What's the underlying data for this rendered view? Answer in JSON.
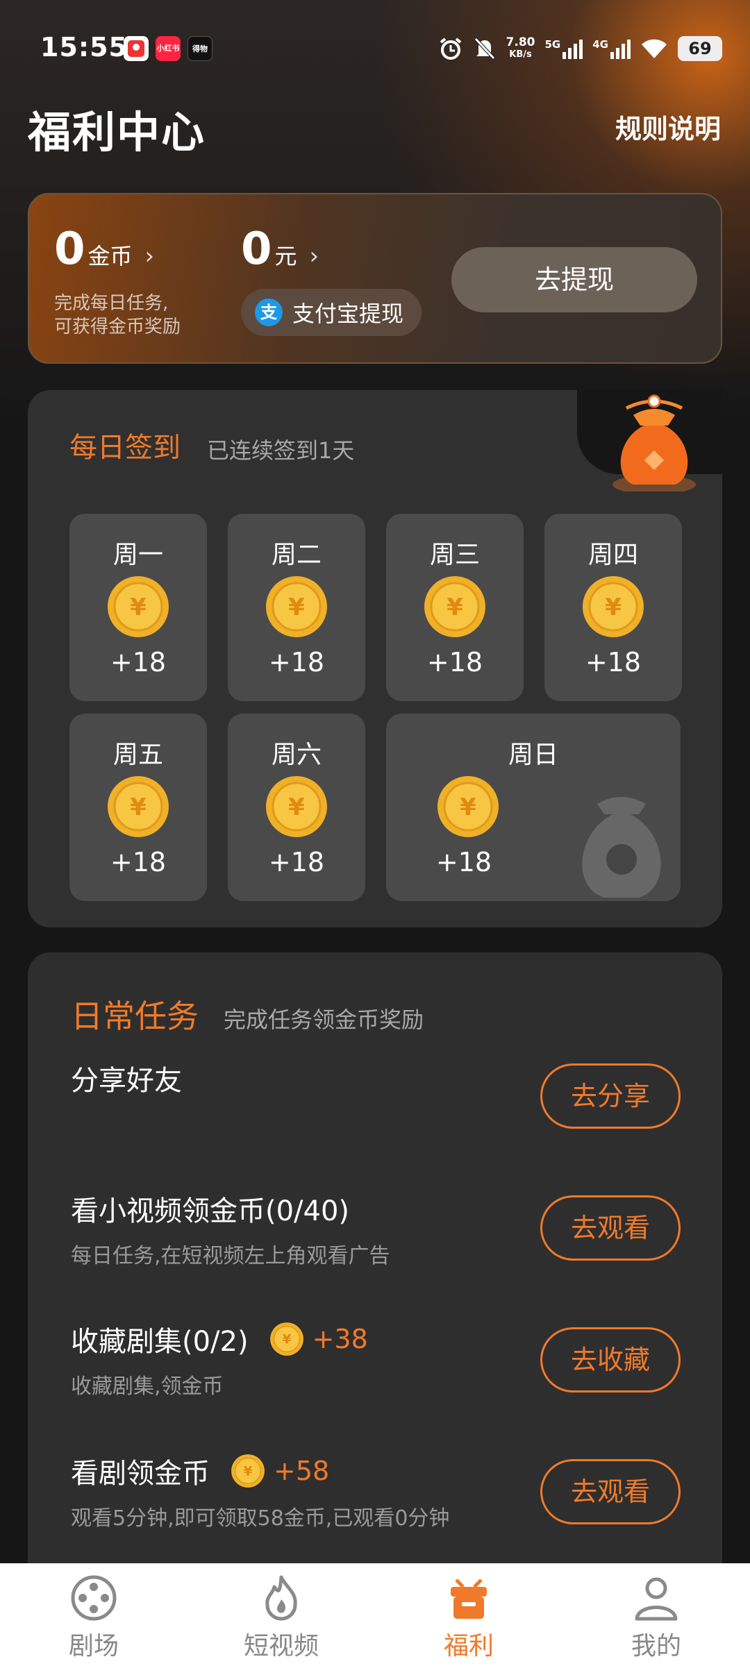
{
  "status_bar": {
    "time": "15:55",
    "apps": [
      "小红书",
      "得物"
    ],
    "speed": "7.80",
    "speed_unit": "KB/s",
    "net1": "5G",
    "net2": "4G",
    "battery": "69"
  },
  "header": {
    "title": "福利中心",
    "rules": "规则说明"
  },
  "wallet": {
    "coins": "0",
    "coin_unit": "金币",
    "cash": "0",
    "cash_unit": "元",
    "desc_line1": "完成每日任务,",
    "desc_line2": "可获得金币奖励",
    "alipay_label": "支付宝提现",
    "withdraw": "去提现"
  },
  "checkin": {
    "title": "每日签到",
    "subtitle": "已连续签到1天",
    "days": [
      {
        "label": "周一",
        "reward": "+18"
      },
      {
        "label": "周二",
        "reward": "+18"
      },
      {
        "label": "周三",
        "reward": "+18"
      },
      {
        "label": "周四",
        "reward": "+18"
      },
      {
        "label": "周五",
        "reward": "+18"
      },
      {
        "label": "周六",
        "reward": "+18"
      },
      {
        "label": "周日",
        "reward": "+18"
      }
    ]
  },
  "tasks": {
    "title": "日常任务",
    "subtitle": "完成任务领金币奖励",
    "items": [
      {
        "name": "分享好友",
        "desc": "",
        "bonus": "",
        "button": "去分享"
      },
      {
        "name": "看小视频领金币(0/40)",
        "desc": "每日任务,在短视频左上角观看广告",
        "bonus": "",
        "button": "去观看"
      },
      {
        "name": "收藏剧集(0/2)",
        "desc": "收藏剧集,领金币",
        "bonus": "+38",
        "button": "去收藏"
      },
      {
        "name": "看剧领金币",
        "desc": "观看5分钟,即可领取58金币,已观看0分钟",
        "bonus": "+58",
        "button": "去观看"
      }
    ]
  },
  "nav": {
    "items": [
      {
        "label": "剧场",
        "icon": "film-reel-icon"
      },
      {
        "label": "短视频",
        "icon": "flame-icon"
      },
      {
        "label": "福利",
        "icon": "gift-bag-icon"
      },
      {
        "label": "我的",
        "icon": "person-icon"
      }
    ],
    "active_index": 2,
    "accent": "#f07a2a"
  },
  "colors": {
    "accent": "#f07a2a",
    "background": "#161616",
    "card": "#303030"
  }
}
